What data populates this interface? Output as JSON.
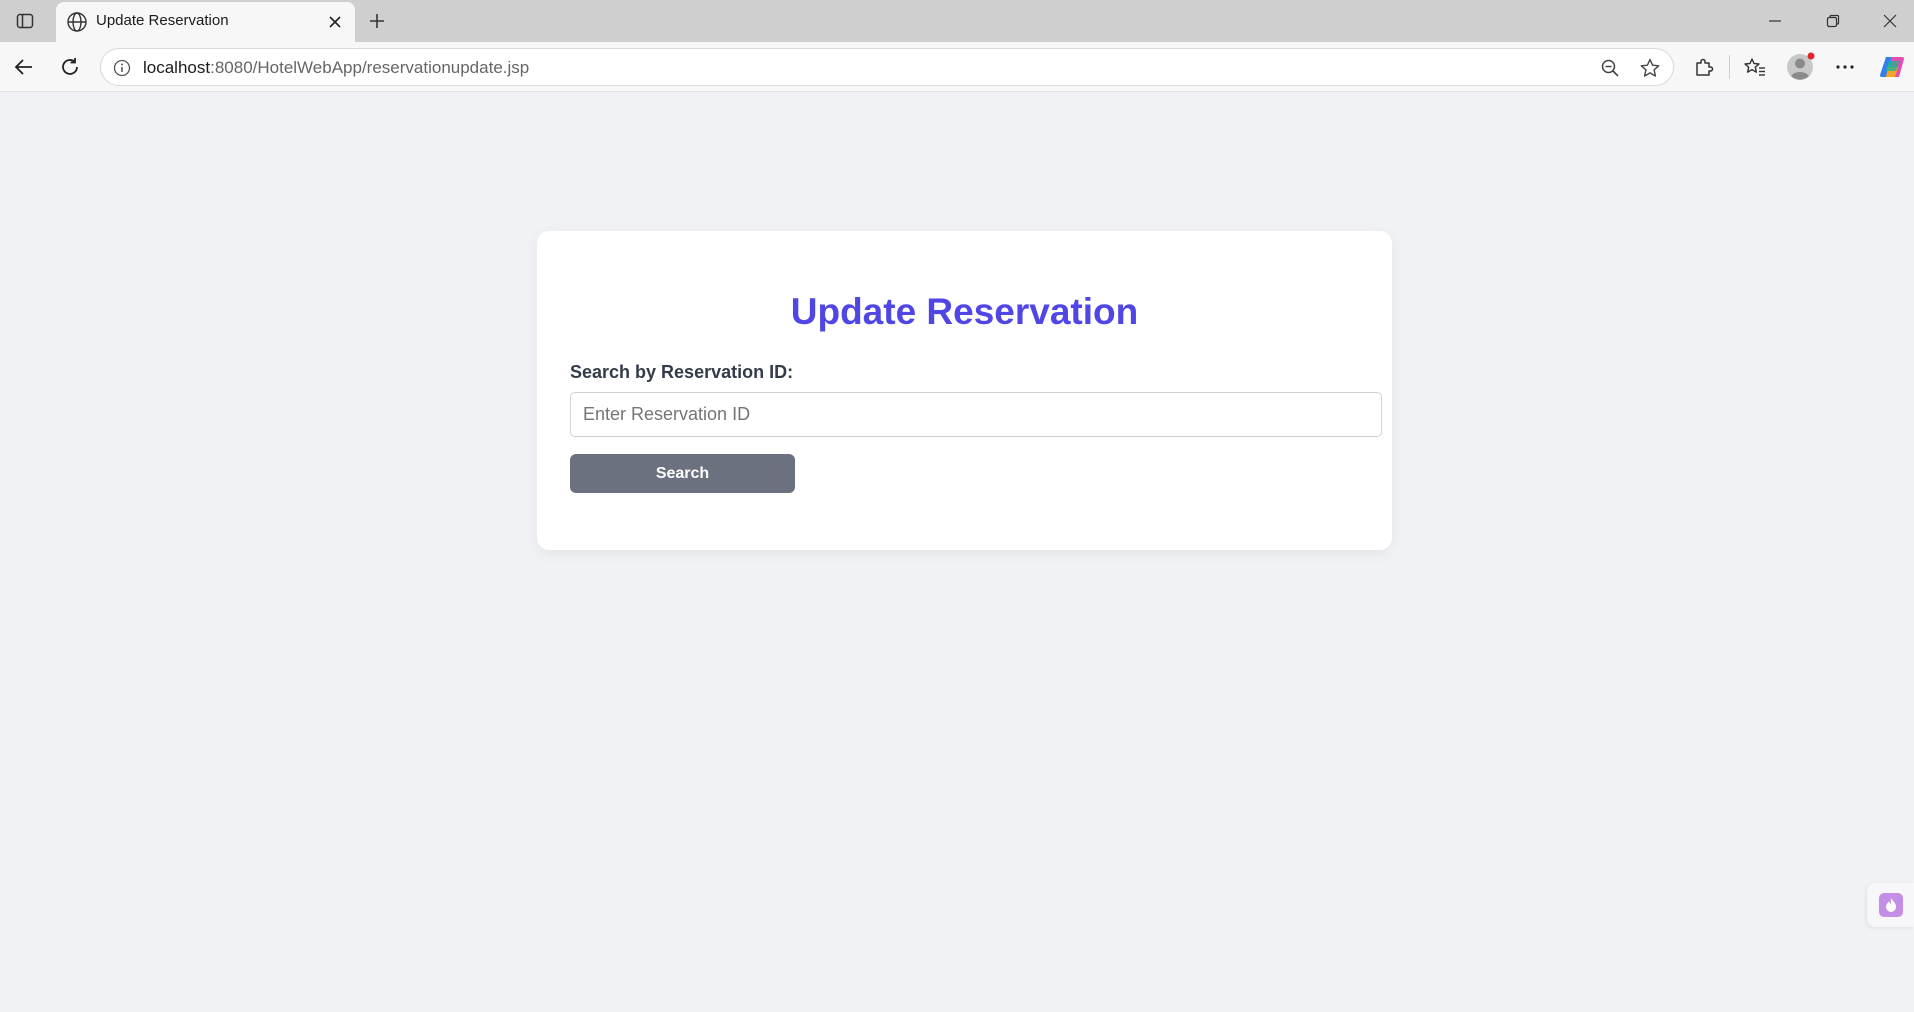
{
  "browser": {
    "tab": {
      "title": "Update Reservation",
      "favicon": "globe-icon"
    },
    "address_bar": {
      "url_host": "localhost",
      "url_rest": ":8080/HotelWebApp/reservationupdate.jsp"
    },
    "icons": {
      "tab_actions": "tab-actions-icon",
      "close_tab": "close-icon",
      "new_tab": "plus-icon",
      "minimize": "minimize-icon",
      "restore": "restore-icon",
      "close_window": "close-icon",
      "back": "back-arrow-icon",
      "refresh": "refresh-icon",
      "site_info": "info-icon",
      "zoom": "zoom-out-icon",
      "favorite": "star-icon",
      "extensions": "puzzle-icon",
      "favorites": "favorites-icon",
      "profile": "profile-icon",
      "more": "more-icon",
      "copilot": "copilot-icon"
    }
  },
  "page": {
    "title": "Update Reservation",
    "search_label": "Search by Reservation ID:",
    "search_input": {
      "placeholder": "Enter Reservation ID",
      "value": ""
    },
    "search_button": "Search"
  },
  "colors": {
    "title": "#4f46e5",
    "button": "#6b717f",
    "page_background": "#f1f2f5",
    "card_background": "#ffffff"
  }
}
